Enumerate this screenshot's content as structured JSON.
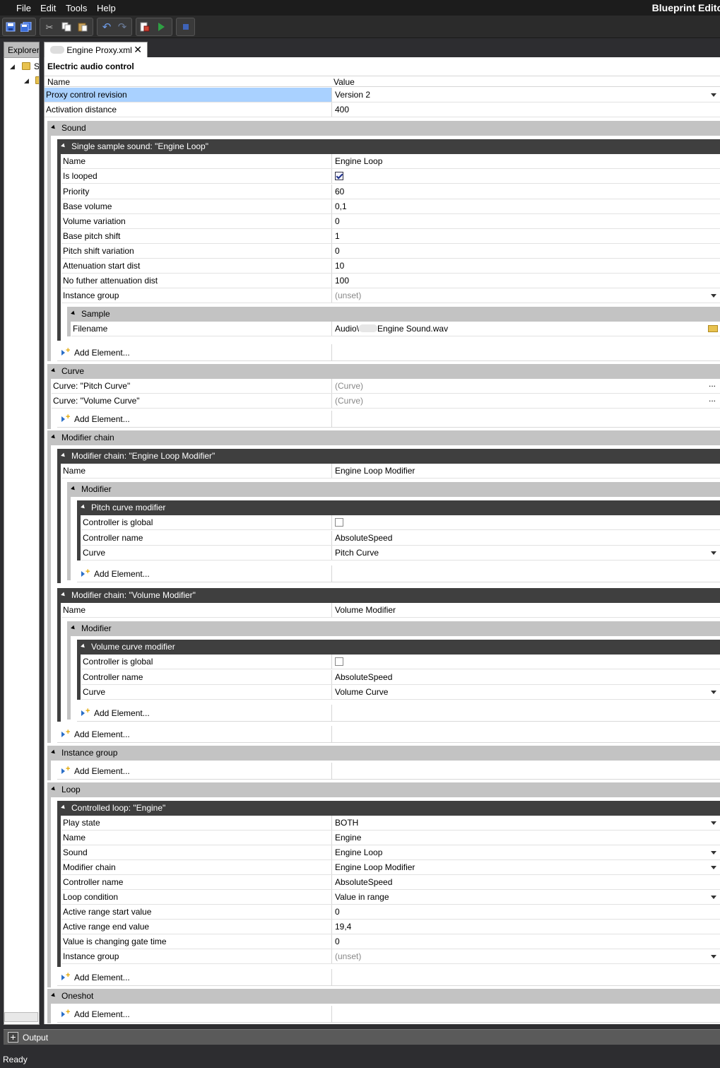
{
  "menu": {
    "file": "File",
    "edit": "Edit",
    "tools": "Tools",
    "help": "Help"
  },
  "app": {
    "title": "Blueprint Edito"
  },
  "tabs": {
    "explorer": "Explorer",
    "document": "Engine Proxy.xml",
    "close_glyph": "✕"
  },
  "explorer": {
    "item_letter": "S"
  },
  "doc": {
    "title": "Electric audio control"
  },
  "header": {
    "name": "Name",
    "value": "Value"
  },
  "add_element_label": "Add Element...",
  "rows": {
    "proxy_revision": {
      "name": "Proxy control revision",
      "value": "Version 2"
    },
    "activation_distance": {
      "name": "Activation distance",
      "value": "400"
    }
  },
  "sound": {
    "section": "Sound",
    "single": {
      "section": "Single sample sound: \"Engine Loop\"",
      "name": {
        "name": "Name",
        "value": "Engine Loop"
      },
      "is_looped": {
        "name": "Is looped",
        "checked": true
      },
      "priority": {
        "name": "Priority",
        "value": "60"
      },
      "base_volume": {
        "name": "Base volume",
        "value": "0,1"
      },
      "volume_variation": {
        "name": "Volume variation",
        "value": "0"
      },
      "base_pitch": {
        "name": "Base pitch shift",
        "value": "1"
      },
      "pitch_variation": {
        "name": "Pitch shift variation",
        "value": "0"
      },
      "att_start": {
        "name": "Attenuation start dist",
        "value": "10"
      },
      "att_end": {
        "name": "No futher attenuation dist",
        "value": "100"
      },
      "instance_group": {
        "name": "Instance group",
        "value": "(unset)"
      },
      "sample": {
        "section": "Sample",
        "filename": {
          "name": "Filename",
          "value_prefix": "Audio\\",
          "value_suffix": "Engine Sound.wav"
        }
      }
    }
  },
  "curve": {
    "section": "Curve",
    "pitch": {
      "name": "Curve: \"Pitch Curve\"",
      "value": "(Curve)"
    },
    "volume": {
      "name": "Curve: \"Volume Curve\"",
      "value": "(Curve)"
    },
    "dots": "..."
  },
  "modifier_chain": {
    "section": "Modifier chain",
    "engine": {
      "section": "Modifier chain: \"Engine Loop Modifier\"",
      "name": {
        "name": "Name",
        "value": "Engine Loop Modifier"
      },
      "modifier_section": "Modifier",
      "pitch_mod": {
        "section": "Pitch curve modifier",
        "global": {
          "name": "Controller is global",
          "checked": false
        },
        "controller": {
          "name": "Controller name",
          "value": "AbsoluteSpeed"
        },
        "curve": {
          "name": "Curve",
          "value": "Pitch Curve"
        }
      }
    },
    "volume": {
      "section": "Modifier chain: \"Volume Modifier\"",
      "name": {
        "name": "Name",
        "value": "Volume Modifier"
      },
      "modifier_section": "Modifier",
      "vol_mod": {
        "section": "Volume curve modifier",
        "global": {
          "name": "Controller is global",
          "checked": false
        },
        "controller": {
          "name": "Controller name",
          "value": "AbsoluteSpeed"
        },
        "curve": {
          "name": "Curve",
          "value": "Volume Curve"
        }
      }
    }
  },
  "instance_group": {
    "section": "Instance group"
  },
  "loop": {
    "section": "Loop",
    "controlled": {
      "section": "Controlled loop: \"Engine\"",
      "play_state": {
        "name": "Play state",
        "value": "BOTH"
      },
      "name": {
        "name": "Name",
        "value": "Engine"
      },
      "sound": {
        "name": "Sound",
        "value": "Engine Loop"
      },
      "modifier_chain": {
        "name": "Modifier chain",
        "value": "Engine Loop Modifier"
      },
      "controller": {
        "name": "Controller name",
        "value": "AbsoluteSpeed"
      },
      "condition": {
        "name": "Loop condition",
        "value": "Value in range"
      },
      "range_start": {
        "name": "Active range start value",
        "value": "0"
      },
      "range_end": {
        "name": "Active range end value",
        "value": "19,4"
      },
      "gate_time": {
        "name": "Value is changing gate time",
        "value": "0"
      },
      "instance_group": {
        "name": "Instance group",
        "value": "(unset)"
      }
    }
  },
  "oneshot": {
    "section": "Oneshot"
  },
  "output": {
    "label": "Output",
    "plus": "+"
  },
  "status": {
    "text": "Ready"
  }
}
